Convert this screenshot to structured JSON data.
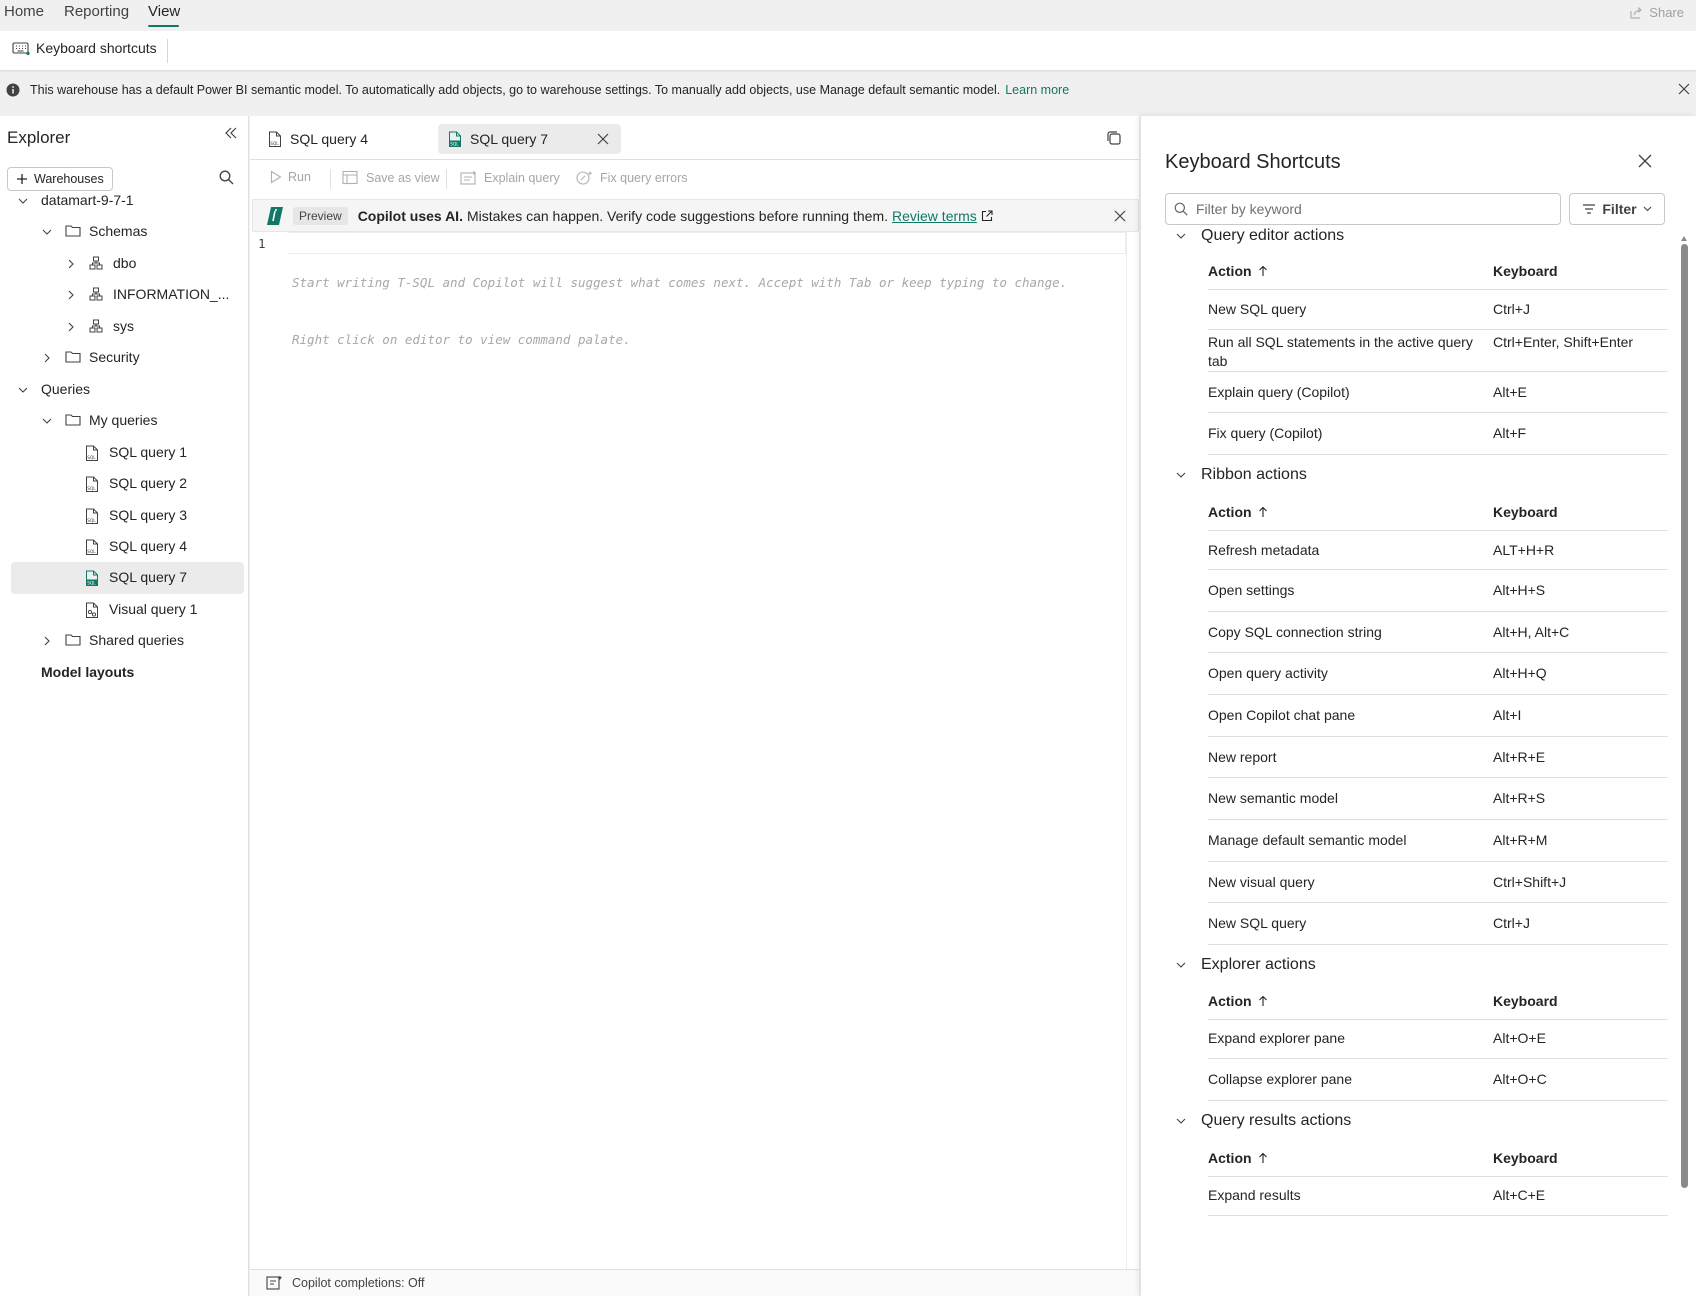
{
  "menu": {
    "tabs": [
      {
        "label": "Home"
      },
      {
        "label": "Reporting"
      },
      {
        "label": "View"
      }
    ],
    "active": "View",
    "share_label": "Share"
  },
  "ribbon": {
    "keyboard_shortcuts_label": "Keyboard shortcuts"
  },
  "infobar": {
    "message": "This warehouse has a default Power BI semantic model. To automatically add objects, go to warehouse settings. To manually add objects, use Manage default semantic model.",
    "link": "Learn more"
  },
  "explorer": {
    "title": "Explorer",
    "warehouses_label": "Warehouses",
    "tree": [
      {
        "label": "datamart-9-7-1",
        "icon": "none",
        "chevron": "down",
        "bold": false
      },
      {
        "label": "Schemas",
        "icon": "folder-icon",
        "chevron": "down"
      },
      {
        "label": "dbo",
        "icon": "schema-icon",
        "chevron": "right"
      },
      {
        "label": "INFORMATION_...",
        "icon": "schema-icon",
        "chevron": "right"
      },
      {
        "label": "sys",
        "icon": "schema-icon",
        "chevron": "right"
      },
      {
        "label": "Security",
        "icon": "folder-icon",
        "chevron": "right"
      },
      {
        "label": "Queries",
        "icon": "none",
        "chevron": "down"
      },
      {
        "label": "My queries",
        "icon": "folder-icon",
        "chevron": "down"
      },
      {
        "label": "SQL query 1",
        "icon": "sql-file-icon",
        "chevron": "none"
      },
      {
        "label": "SQL query 2",
        "icon": "sql-file-icon",
        "chevron": "none"
      },
      {
        "label": "SQL query 3",
        "icon": "sql-file-icon",
        "chevron": "none"
      },
      {
        "label": "SQL query 4",
        "icon": "sql-file-icon",
        "chevron": "none"
      },
      {
        "label": "SQL query 7",
        "icon": "sql-file-icon",
        "chevron": "none",
        "selected": true
      },
      {
        "label": "Visual query 1",
        "icon": "visual-query-icon",
        "chevron": "none"
      },
      {
        "label": "Shared queries",
        "icon": "folder-icon",
        "chevron": "right"
      },
      {
        "label": "Model layouts",
        "icon": "none",
        "chevron": "none",
        "bold": true
      }
    ]
  },
  "editor": {
    "tabs": [
      {
        "label": "SQL query 4",
        "active": false
      },
      {
        "label": "SQL query 7",
        "active": true
      }
    ],
    "toolbar": {
      "run": "Run",
      "save_as_view": "Save as view",
      "explain_query": "Explain query",
      "fix_query_errors": "Fix query errors"
    },
    "copilot_banner": {
      "badge": "Preview",
      "bold": "Copilot uses AI.",
      "text": "Mistakes can happen. Verify code suggestions before running them.",
      "link": "Review terms"
    },
    "line_number": "1",
    "placeholder_line1": "Start writing T-SQL and Copilot will suggest what comes next. Accept with Tab or keep typing to change.",
    "placeholder_line2": "Right click on editor to view command palate.",
    "status": "Copilot completions: Off"
  },
  "shortcuts": {
    "title": "Keyboard Shortcuts",
    "filter_placeholder": "Filter by keyword",
    "filter_button": "Filter",
    "col_action": "Action",
    "col_keyboard": "Keyboard",
    "sections": [
      {
        "title": "Query editor actions",
        "rows": [
          {
            "action": "New SQL query",
            "keys": "Ctrl+J"
          },
          {
            "action": "Run all SQL statements in the active query tab",
            "keys": "Ctrl+Enter, Shift+Enter"
          },
          {
            "action": "Explain query (Copilot)",
            "keys": "Alt+E"
          },
          {
            "action": "Fix query (Copilot)",
            "keys": "Alt+F"
          }
        ]
      },
      {
        "title": "Ribbon actions",
        "rows": [
          {
            "action": "Refresh metadata",
            "keys": "ALT+H+R"
          },
          {
            "action": "Open settings",
            "keys": "Alt+H+S"
          },
          {
            "action": "Copy SQL connection string",
            "keys": "Alt+H, Alt+C"
          },
          {
            "action": "Open query activity",
            "keys": "Alt+H+Q"
          },
          {
            "action": "Open Copilot chat pane",
            "keys": "Alt+I"
          },
          {
            "action": "New report",
            "keys": "Alt+R+E"
          },
          {
            "action": "New semantic model",
            "keys": "Alt+R+S"
          },
          {
            "action": "Manage default semantic model",
            "keys": "Alt+R+M"
          },
          {
            "action": "New visual query",
            "keys": "Ctrl+Shift+J"
          },
          {
            "action": "New SQL query",
            "keys": "Ctrl+J"
          }
        ]
      },
      {
        "title": "Explorer actions",
        "rows": [
          {
            "action": "Expand explorer pane",
            "keys": "Alt+O+E"
          },
          {
            "action": "Collapse explorer pane",
            "keys": "Alt+O+C"
          }
        ]
      },
      {
        "title": "Query results actions",
        "rows": [
          {
            "action": "Expand results",
            "keys": "Alt+C+E"
          }
        ]
      }
    ]
  },
  "colors": {
    "accent": "#117865",
    "selected_bg": "#ebebeb"
  }
}
